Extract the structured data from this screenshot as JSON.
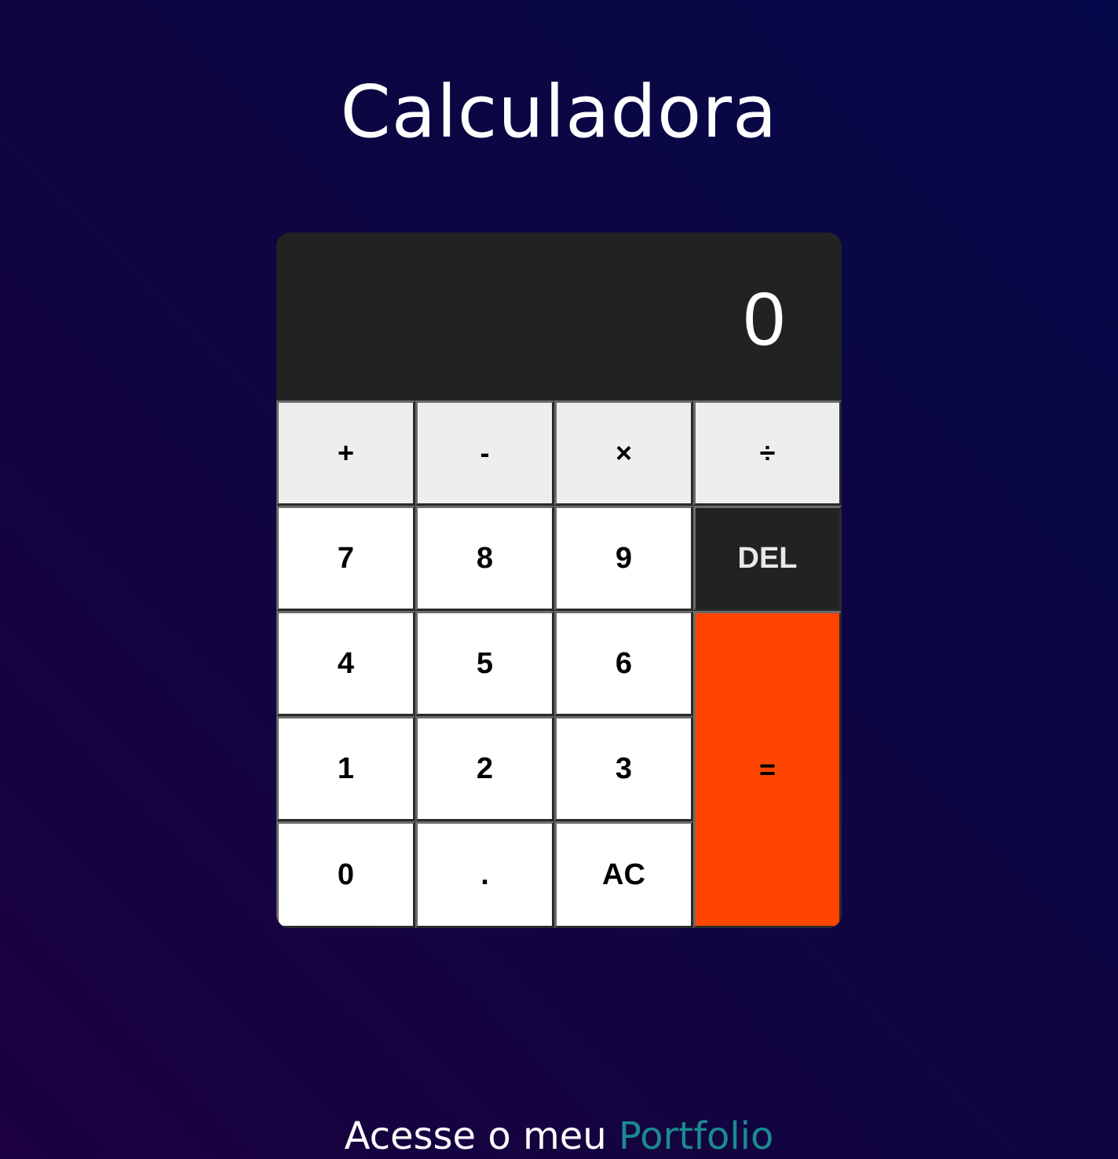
{
  "page": {
    "title": "Calculadora"
  },
  "display": {
    "value": "0"
  },
  "keys": {
    "add": "+",
    "subtract": "-",
    "multiply": "×",
    "divide": "÷",
    "seven": "7",
    "eight": "8",
    "nine": "9",
    "del": "DEL",
    "four": "4",
    "five": "5",
    "six": "6",
    "equals": "=",
    "one": "1",
    "two": "2",
    "three": "3",
    "zero": "0",
    "decimal": ".",
    "clear": "AC"
  },
  "footer": {
    "prefix": "Acesse o meu ",
    "link_text": "Portfolio"
  },
  "colors": {
    "equals_key": "#ff4500",
    "display_bg": "#222222",
    "link": "#1a8a8f"
  }
}
